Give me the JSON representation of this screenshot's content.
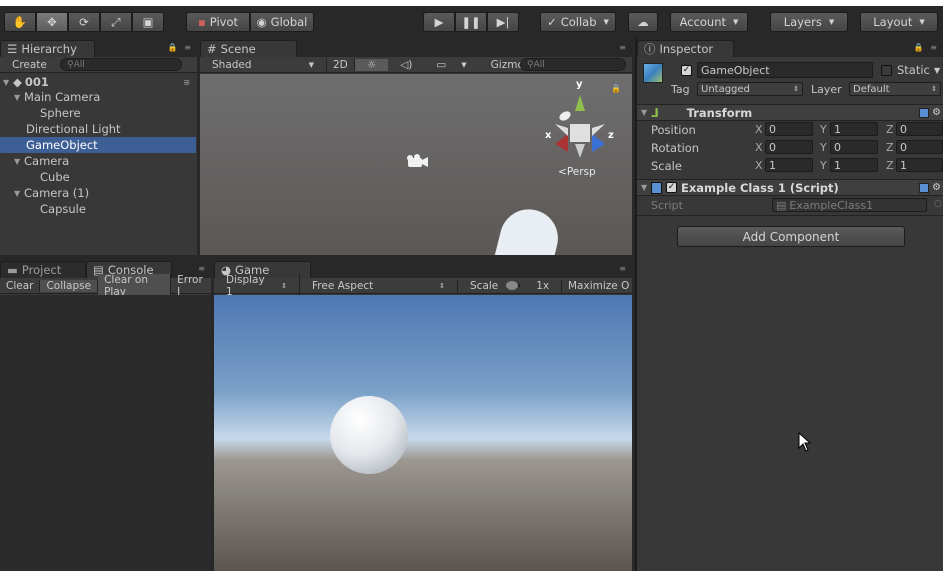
{
  "toolbar": {
    "pivot": "Pivot",
    "global": "Global",
    "collab": "Collab",
    "account": "Account",
    "layers": "Layers",
    "layout": "Layout"
  },
  "hierarchy": {
    "tab": "Hierarchy",
    "create": "Create",
    "search": "All",
    "scene": "001",
    "items": [
      {
        "label": "Main Camera"
      },
      {
        "label": "Sphere"
      },
      {
        "label": "Directional Light"
      },
      {
        "label": "GameObject"
      },
      {
        "label": "Camera"
      },
      {
        "label": "Cube"
      },
      {
        "label": "Camera (1)"
      },
      {
        "label": "Capsule"
      }
    ]
  },
  "scene": {
    "tab": "Scene",
    "shading": "Shaded",
    "mode2d": "2D",
    "gizmos": "Gizmos",
    "search": "All",
    "persp": "Persp",
    "axis_y": "y",
    "axis_x": "x",
    "axis_z": "z"
  },
  "project": {
    "tab": "Project"
  },
  "console": {
    "tab": "Console",
    "clear": "Clear",
    "collapse": "Collapse",
    "clear_on_play": "Clear on Play",
    "error_pause": "Error I"
  },
  "game": {
    "tab": "Game",
    "display": "Display 1",
    "aspect": "Free Aspect",
    "scale_label": "Scale",
    "scale_value": "1x",
    "maximize": "Maximize O"
  },
  "inspector": {
    "tab": "Inspector",
    "name": "GameObject",
    "static": "Static",
    "tag_label": "Tag",
    "tag_value": "Untagged",
    "layer_label": "Layer",
    "layer_value": "Default",
    "transform": {
      "title": "Transform",
      "rows": [
        {
          "label": "Position",
          "x": "0",
          "y": "1",
          "z": "0"
        },
        {
          "label": "Rotation",
          "x": "0",
          "y": "0",
          "z": "0"
        },
        {
          "label": "Scale",
          "x": "1",
          "y": "1",
          "z": "1"
        }
      ]
    },
    "script_comp": {
      "title": "Example Class 1 (Script)",
      "script_label": "Script",
      "script_value": "ExampleClass1"
    },
    "add_component": "Add Component"
  },
  "axes": {
    "x": "X",
    "y": "Y",
    "z": "Z"
  },
  "colors": {
    "selection": "#3e5f96",
    "panel": "#383838",
    "axis_x": "#c0392b",
    "axis_y": "#8fbf4a",
    "axis_z": "#3a6fd6"
  }
}
